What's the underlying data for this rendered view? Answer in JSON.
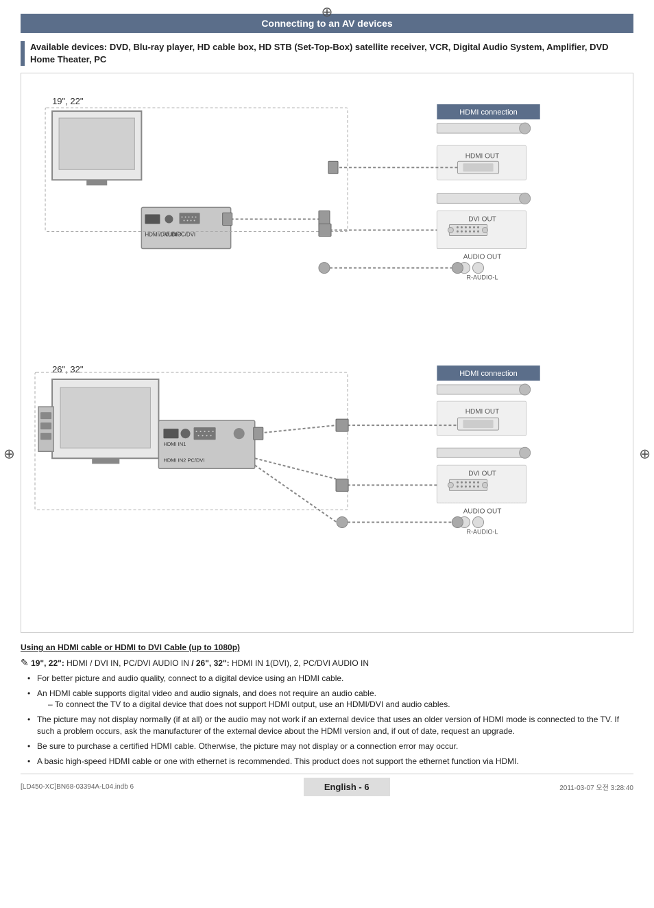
{
  "page": {
    "title": "Connecting to an AV devices",
    "available_devices_label": "Available devices: DVD, Blu-ray player, HD cable box, HD STB (Set-Top-Box) satellite receiver, VCR, Digital Audio System, Amplifier, DVD Home Theater, PC"
  },
  "sections": {
    "section1_label": "19\", 22\"",
    "section2_label": "26\", 32\"",
    "hdmi_connection_label": "HDMI connection",
    "hdmi_out_label": "HDMI OUT",
    "dvi_out_label": "DVI OUT",
    "audio_out_label": "AUDIO OUT",
    "r_audio_l_label": "R-AUDIO-L"
  },
  "notes": {
    "title": "Using an HDMI cable or HDMI to DVI Cable (up to 1080p)",
    "model_note": "19\", 22\": HDMI / DVI IN, PC/DVI AUDIO IN / 26\", 32\": HDMI IN 1(DVI), 2, PC/DVI AUDIO IN",
    "bullets": [
      "For better picture and audio quality, connect to a digital device using an HDMI cable.",
      "An HDMI cable supports digital video and audio signals, and does not require an audio cable.",
      "To connect the TV to a digital device that does not support HDMI output, use an HDMI/DVI and audio cables.",
      "The picture may not display normally (if at all) or the audio may not work if an external device that uses an older version of HDMI mode is connected to the TV. If such a problem occurs, ask the manufacturer of the external device about the HDMI version and, if out of date, request an upgrade.",
      "Be sure to purchase a certified HDMI cable. Otherwise, the picture may not display or a connection error may occur.",
      "A basic high-speed HDMI cable or one with ethernet is recommended. This product does not support the ethernet function via HDMI."
    ]
  },
  "footer": {
    "left_text": "[LD450-XC]BN68-03394A-L04.indb   6",
    "page_label": "English - 6",
    "right_text": "2011-03-07   오전 3:28:40"
  },
  "crosshairs": {
    "top": "⊕",
    "left": "⊕",
    "right": "⊕",
    "tl": "",
    "tr": "",
    "bl": "",
    "br": ""
  }
}
